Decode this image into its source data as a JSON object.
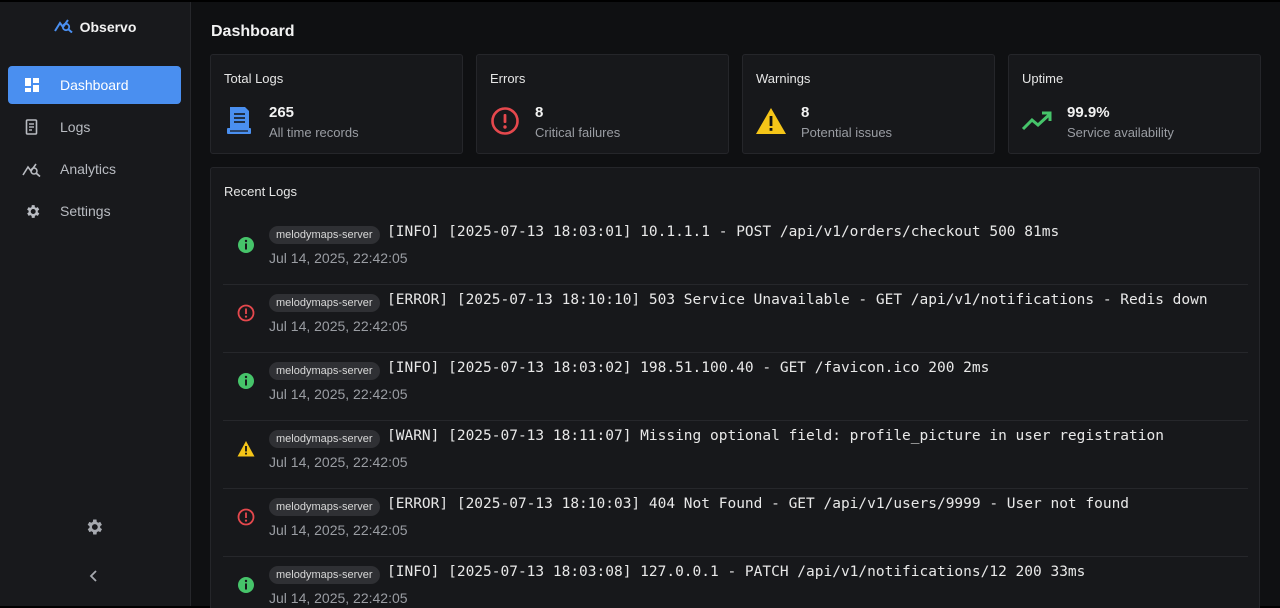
{
  "app": {
    "name": "Observo"
  },
  "sidebar": {
    "items": [
      {
        "label": "Dashboard",
        "icon": "dashboard-icon"
      },
      {
        "label": "Logs",
        "icon": "logs-icon"
      },
      {
        "label": "Analytics",
        "icon": "analytics-icon"
      },
      {
        "label": "Settings",
        "icon": "settings-icon"
      }
    ],
    "active": "Dashboard"
  },
  "page": {
    "title": "Dashboard"
  },
  "stats": [
    {
      "title": "Total Logs",
      "value": "265",
      "sub": "All time records",
      "icon": "document-icon",
      "color": "#4a8ff0"
    },
    {
      "title": "Errors",
      "value": "8",
      "sub": "Critical failures",
      "icon": "error-circle-icon",
      "color": "#e5484d"
    },
    {
      "title": "Warnings",
      "value": "8",
      "sub": "Potential issues",
      "icon": "warning-triangle-icon",
      "color": "#f5c518"
    },
    {
      "title": "Uptime",
      "value": "99.9%",
      "sub": "Service availability",
      "icon": "trending-up-icon",
      "color": "#46c46a"
    }
  ],
  "recent_logs": {
    "title": "Recent Logs",
    "rows": [
      {
        "level": "info",
        "source": "melodymaps-server",
        "message": "[INFO] [2025-07-13 18:03:01] 10.1.1.1 - POST /api/v1/orders/checkout 500 81ms",
        "time": "Jul 14, 2025, 22:42:05"
      },
      {
        "level": "error",
        "source": "melodymaps-server",
        "message": "[ERROR] [2025-07-13 18:10:10] 503 Service Unavailable - GET /api/v1/notifications - Redis down",
        "time": "Jul 14, 2025, 22:42:05"
      },
      {
        "level": "info",
        "source": "melodymaps-server",
        "message": "[INFO] [2025-07-13 18:03:02] 198.51.100.40 - GET /favicon.ico 200 2ms",
        "time": "Jul 14, 2025, 22:42:05"
      },
      {
        "level": "warn",
        "source": "melodymaps-server",
        "message": "[WARN] [2025-07-13 18:11:07] Missing optional field: profile_picture in user registration",
        "time": "Jul 14, 2025, 22:42:05"
      },
      {
        "level": "error",
        "source": "melodymaps-server",
        "message": "[ERROR] [2025-07-13 18:10:03] 404 Not Found - GET /api/v1/users/9999 - User not found",
        "time": "Jul 14, 2025, 22:42:05"
      },
      {
        "level": "info",
        "source": "melodymaps-server",
        "message": "[INFO] [2025-07-13 18:03:08] 127.0.0.1 - PATCH /api/v1/notifications/12 200 33ms",
        "time": "Jul 14, 2025, 22:42:05"
      }
    ]
  },
  "colors": {
    "accent": "#4a8ff0",
    "info": "#46c46a",
    "error": "#e5484d",
    "warn": "#f5c518"
  }
}
